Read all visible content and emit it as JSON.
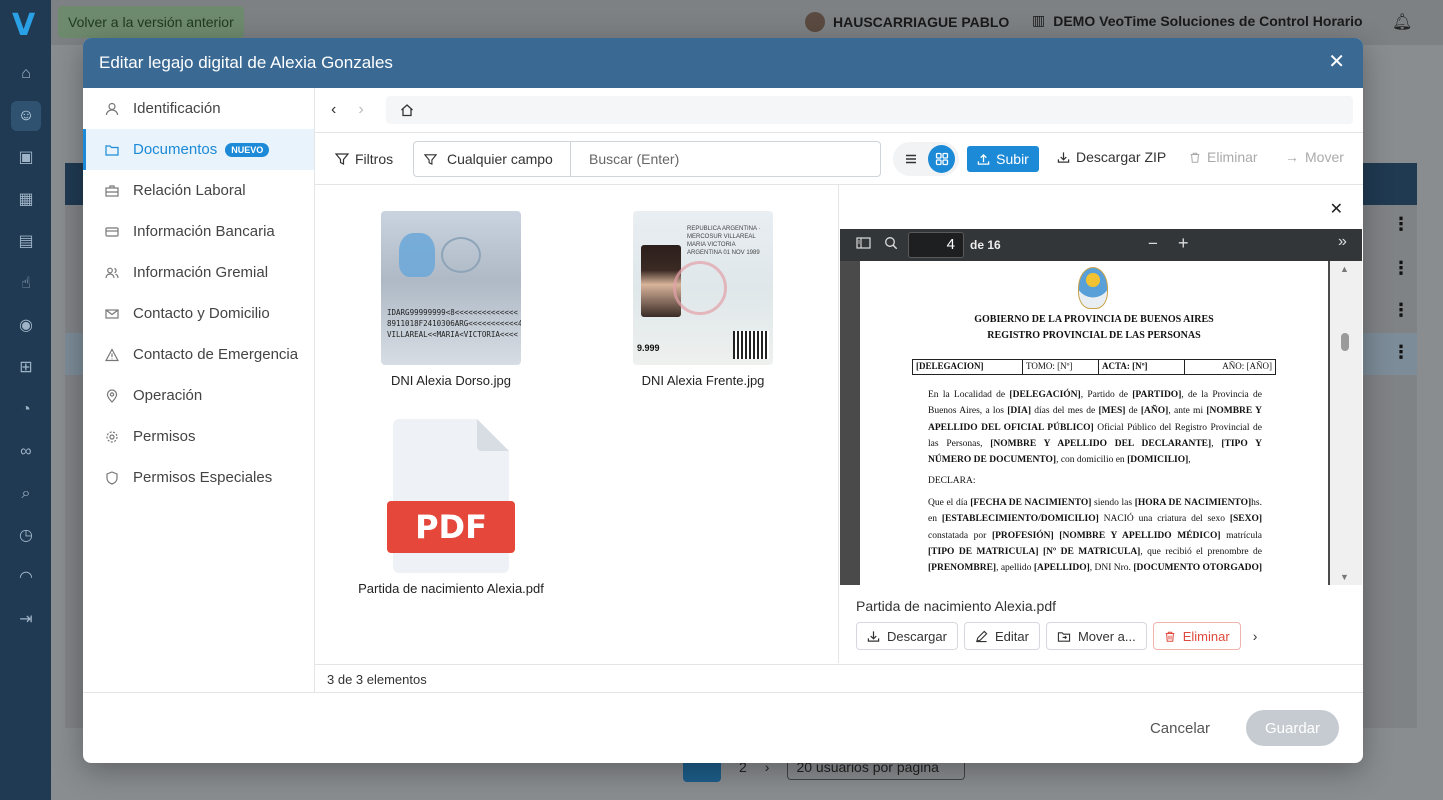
{
  "topbar": {
    "prev_version": "Volver a la versión anterior",
    "user_name": "HAUSCARRIAGUE PABLO",
    "company": "DEMO VeoTime Soluciones de Control Horario"
  },
  "modal": {
    "title": "Editar legajo digital de Alexia Gonzales",
    "nav": [
      {
        "label": "Identificación",
        "icon": "user-icon"
      },
      {
        "label": "Documentos",
        "icon": "folder-icon",
        "badge": "NUEVO",
        "active": true
      },
      {
        "label": "Relación Laboral",
        "icon": "briefcase-icon"
      },
      {
        "label": "Información Bancaria",
        "icon": "credit-card-icon"
      },
      {
        "label": "Información Gremial",
        "icon": "users-icon"
      },
      {
        "label": "Contacto y Domicilio",
        "icon": "mail-icon"
      },
      {
        "label": "Contacto de Emergencia",
        "icon": "warning-icon"
      },
      {
        "label": "Operación",
        "icon": "map-pin-icon"
      },
      {
        "label": "Permisos",
        "icon": "gear-icon"
      },
      {
        "label": "Permisos Especiales",
        "icon": "shield-icon"
      }
    ],
    "toolbar": {
      "filters": "Filtros",
      "search_field": "Cualquier campo",
      "search_placeholder": "Buscar (Enter)",
      "upload": "Subir",
      "download_zip": "Descargar ZIP",
      "delete": "Eliminar",
      "move": "Mover"
    },
    "files": [
      {
        "name": "DNI Alexia Dorso.jpg",
        "type": "image"
      },
      {
        "name": "DNI Alexia Frente.jpg",
        "type": "image"
      },
      {
        "name": "Partida de nacimiento Alexia.pdf",
        "type": "pdf"
      }
    ],
    "pdf_badge": "PDF",
    "thumb_text": {
      "mrz_1": "IDARG99999999<8<<<<<<<<<<<<<<",
      "mrz_2": "8911018F2410306ARG<<<<<<<<<<<4",
      "mrz_3": "VILLAREAL<<MARIA<VICTORIA<<<<",
      "front_lines": "REPUBLICA ARGENTINA · MERCOSUR VILLAREAL MARIA VICTORIA ARGENTINA 01 NOV 1989",
      "front_doc": "9.999"
    },
    "preview": {
      "page": "4",
      "page_of": "de 16",
      "file_name": "Partida de nacimiento Alexia.pdf",
      "actions": {
        "download": "Descargar",
        "edit": "Editar",
        "move": "Mover a...",
        "delete": "Eliminar"
      },
      "doc": {
        "heading_1": "GOBIERNO DE LA PROVINCIA DE BUENOS AIRES",
        "heading_2": "REGISTRO PROVINCIAL DE LAS PERSONAS",
        "table": [
          "[DELEGACION]",
          "TOMO: [Nº]",
          "ACTA: [Nº]",
          "AÑO: [AÑO]"
        ],
        "para_1": "En la Localidad de [DELEGACIÓN], Partido de [PARTIDO], de la Provincia de Buenos Aires, a los [DIA] días del mes de [MES] de [AÑO], ante mi [NOMBRE Y APELLIDO DEL OFICIAL PÚBLICO] Oficial Público del Registro Provincial de las Personas, [NOMBRE Y APELLIDO DEL DECLARANTE], [TIPO Y NÚMERO DE DOCUMENTO], con domicilio en [DOMICILIO],",
        "para_2": "DECLARA:",
        "para_3": "Que el día [FECHA DE NACIMIENTO] siendo las [HORA DE NACIMIENTO]hs. en [ESTABLECIMIENTO/DOMICILIO] NACIÓ una criatura del sexo [SEXO] constatada por [PROFESIÓN] [NOMBRE Y APELLIDO MÉDICO] matrícula [TIPO DE MATRICULA] [Nº DE MATRICULA], que recibió el prenombre de [PRENOMBRE], apellido [APELLIDO], DNI Nro. [DOCUMENTO OTORGADO]"
      }
    },
    "status": "3 de 3 elementos",
    "footer": {
      "cancel": "Cancelar",
      "save": "Guardar"
    }
  },
  "background": {
    "pager_page_2": "2",
    "page_size": "20 usuarios por pagina"
  },
  "colors": {
    "header": "#3a6a94",
    "accent": "#1c8ad6",
    "danger": "#e04a3c",
    "pdf_red": "#e5483b"
  }
}
